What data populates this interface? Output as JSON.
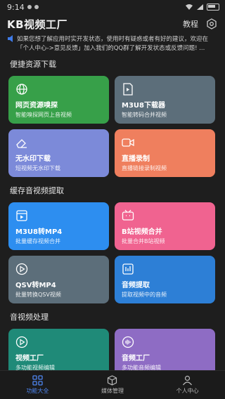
{
  "status": {
    "time": "9:14"
  },
  "header": {
    "title": "KB视频工厂",
    "tutorial_label": "教程",
    "settings_icon": "gear-icon"
  },
  "notice": {
    "icon": "speaker-icon",
    "text": "如果您想了解应用时实开发状态，使用时有疑惑或者有好的建议，欢迎在「个人中心->意见反馈」加入我们的QQ群了解开发状态或反馈问题! ..."
  },
  "sections": [
    {
      "title": "便捷资源下载",
      "cards": [
        {
          "title": "网页资源嗅探",
          "subtitle": "智能嗅探网页上音视频",
          "color": "#37a049",
          "icon": "globe-icon"
        },
        {
          "title": "M3U8下载器",
          "subtitle": "智能转码合并视频",
          "color": "#5c6e7a",
          "icon": "file-video-icon"
        },
        {
          "title": "无水印下载",
          "subtitle": "短视频无水印下载",
          "color": "#7c8ad9",
          "icon": "eraser-icon"
        },
        {
          "title": "直播录制",
          "subtitle": "直播链接录制视频",
          "color": "#ef7f5e",
          "icon": "video-camera-icon"
        }
      ]
    },
    {
      "title": "缓存音视频提取",
      "cards": [
        {
          "title": "M3U8转MP4",
          "subtitle": "批量缓存视频合并",
          "color": "#2d8ef0",
          "icon": "video-file-icon"
        },
        {
          "title": "B站视频合并",
          "subtitle": "批量合并B站视频",
          "color": "#f06390",
          "icon": "tv-icon"
        },
        {
          "title": "QSV转MP4",
          "subtitle": "批量转换QSV视频",
          "color": "#5c6e7a",
          "icon": "play-circle-icon"
        },
        {
          "title": "音频提取",
          "subtitle": "提取视频中的音频",
          "color": "#2d7fd6",
          "icon": "audio-extract-icon"
        }
      ]
    },
    {
      "title": "音视频处理",
      "cards": [
        {
          "title": "视频工厂",
          "subtitle": "多功能视频编辑",
          "color": "#1f8a78",
          "icon": "play-circle-icon"
        },
        {
          "title": "音频工厂",
          "subtitle": "多功能音频编辑",
          "color": "#8e6cc4",
          "icon": "audio-wave-icon"
        }
      ]
    }
  ],
  "bottom_nav": [
    {
      "label": "功能大全",
      "icon": "grid-icon",
      "active": true
    },
    {
      "label": "媒体管理",
      "icon": "cube-icon",
      "active": false
    },
    {
      "label": "个人中心",
      "icon": "person-icon",
      "active": false
    }
  ]
}
